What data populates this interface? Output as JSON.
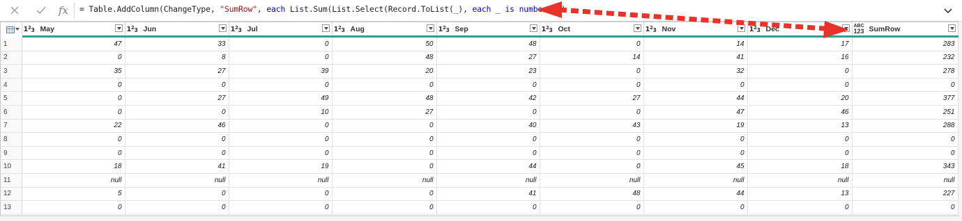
{
  "formula_bar": {
    "cancel_icon": "close-icon",
    "confirm_icon": "check-icon",
    "fx_label": "fx",
    "formula": {
      "prefix": "= Table.AddColumn(ChangeType, ",
      "string_arg": "\"SumRow\"",
      "mid1": ", ",
      "kw_each1": "each",
      "mid2": " List.Sum(List.Select(Record.ToList(_), ",
      "kw_each2": "each",
      "mid3": " _ ",
      "kw_is": "is",
      "mid4": " ",
      "kw_number": "number",
      "suffix": " )))"
    },
    "expand_icon": "chevron-down-icon"
  },
  "grid": {
    "columns": [
      {
        "label": "May",
        "type": "number"
      },
      {
        "label": "Jun",
        "type": "number"
      },
      {
        "label": "Jul",
        "type": "number"
      },
      {
        "label": "Aug",
        "type": "number"
      },
      {
        "label": "Sep",
        "type": "number"
      },
      {
        "label": "Oct",
        "type": "number"
      },
      {
        "label": "Nov",
        "type": "number"
      },
      {
        "label": "Dec",
        "type": "number"
      },
      {
        "label": "SumRow",
        "type": "any"
      }
    ],
    "type_icon_number": {
      "one": "1",
      "two": "2",
      "three": "3"
    },
    "type_icon_any": {
      "top": "ABC",
      "bottom": "123"
    },
    "rows": [
      {
        "n": "1",
        "cells": [
          "47",
          "33",
          "0",
          "50",
          "48",
          "0",
          "14",
          "17",
          "283"
        ]
      },
      {
        "n": "2",
        "cells": [
          "0",
          "8",
          "0",
          "48",
          "27",
          "14",
          "41",
          "16",
          "232"
        ]
      },
      {
        "n": "3",
        "cells": [
          "35",
          "27",
          "39",
          "20",
          "23",
          "0",
          "32",
          "0",
          "278"
        ]
      },
      {
        "n": "4",
        "cells": [
          "0",
          "0",
          "0",
          "0",
          "0",
          "0",
          "0",
          "0",
          "0"
        ]
      },
      {
        "n": "5",
        "cells": [
          "0",
          "27",
          "49",
          "48",
          "42",
          "27",
          "44",
          "20",
          "377"
        ]
      },
      {
        "n": "6",
        "cells": [
          "0",
          "0",
          "10",
          "27",
          "0",
          "0",
          "47",
          "46",
          "251"
        ]
      },
      {
        "n": "7",
        "cells": [
          "22",
          "46",
          "0",
          "0",
          "40",
          "43",
          "19",
          "13",
          "288"
        ]
      },
      {
        "n": "8",
        "cells": [
          "0",
          "0",
          "0",
          "0",
          "0",
          "0",
          "0",
          "0",
          "0"
        ]
      },
      {
        "n": "9",
        "cells": [
          "0",
          "0",
          "0",
          "0",
          "0",
          "0",
          "0",
          "0",
          "0"
        ]
      },
      {
        "n": "10",
        "cells": [
          "18",
          "41",
          "19",
          "0",
          "44",
          "0",
          "45",
          "18",
          "343"
        ]
      },
      {
        "n": "11",
        "cells": [
          "null",
          "null",
          "null",
          "null",
          "null",
          "null",
          "null",
          "null",
          "null"
        ]
      },
      {
        "n": "12",
        "cells": [
          "5",
          "0",
          "0",
          "0",
          "41",
          "48",
          "44",
          "13",
          "227"
        ]
      },
      {
        "n": "13",
        "cells": [
          "0",
          "0",
          "0",
          "0",
          "0",
          "0",
          "0",
          "0",
          "0"
        ]
      }
    ]
  },
  "colors": {
    "header_underline": "#2aa096",
    "annotation_arrow": "#e8332a",
    "string_token": "#a31515",
    "keyword_token": "#0000ff"
  }
}
